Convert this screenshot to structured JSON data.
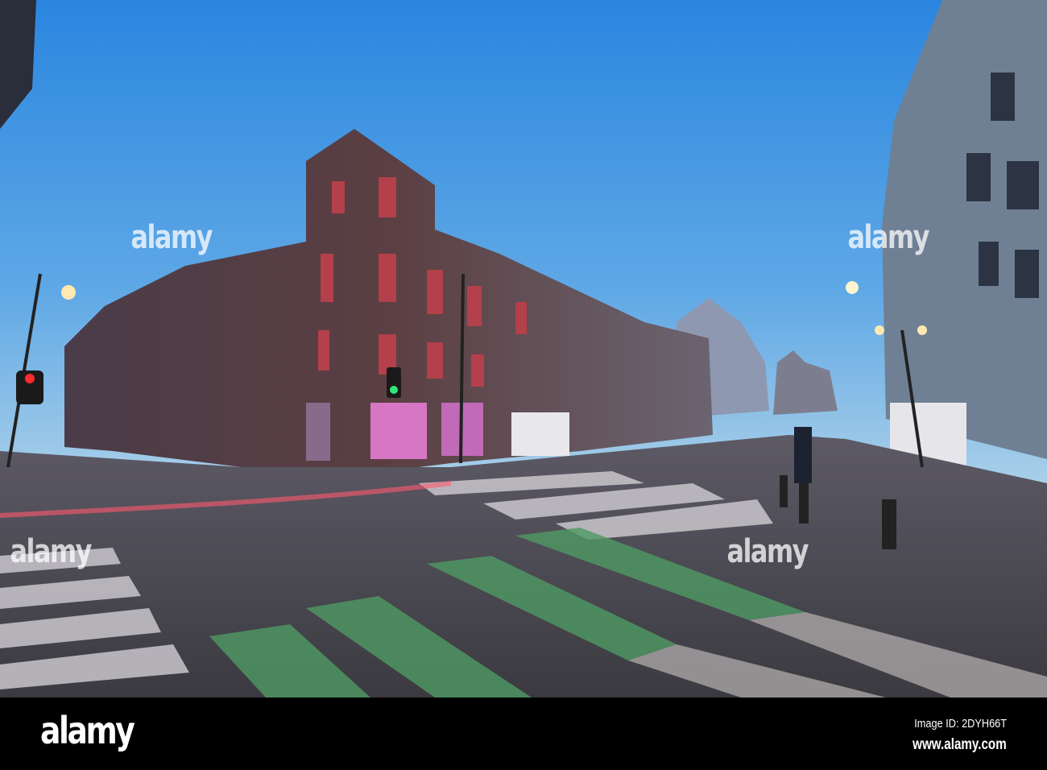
{
  "photo": {
    "subject": "street-scene"
  },
  "watermark": {
    "text": "alamy"
  },
  "footer": {
    "logo": "alamy",
    "image_id": "Image ID: 2DYH66T",
    "website": "www.alamy.com"
  }
}
